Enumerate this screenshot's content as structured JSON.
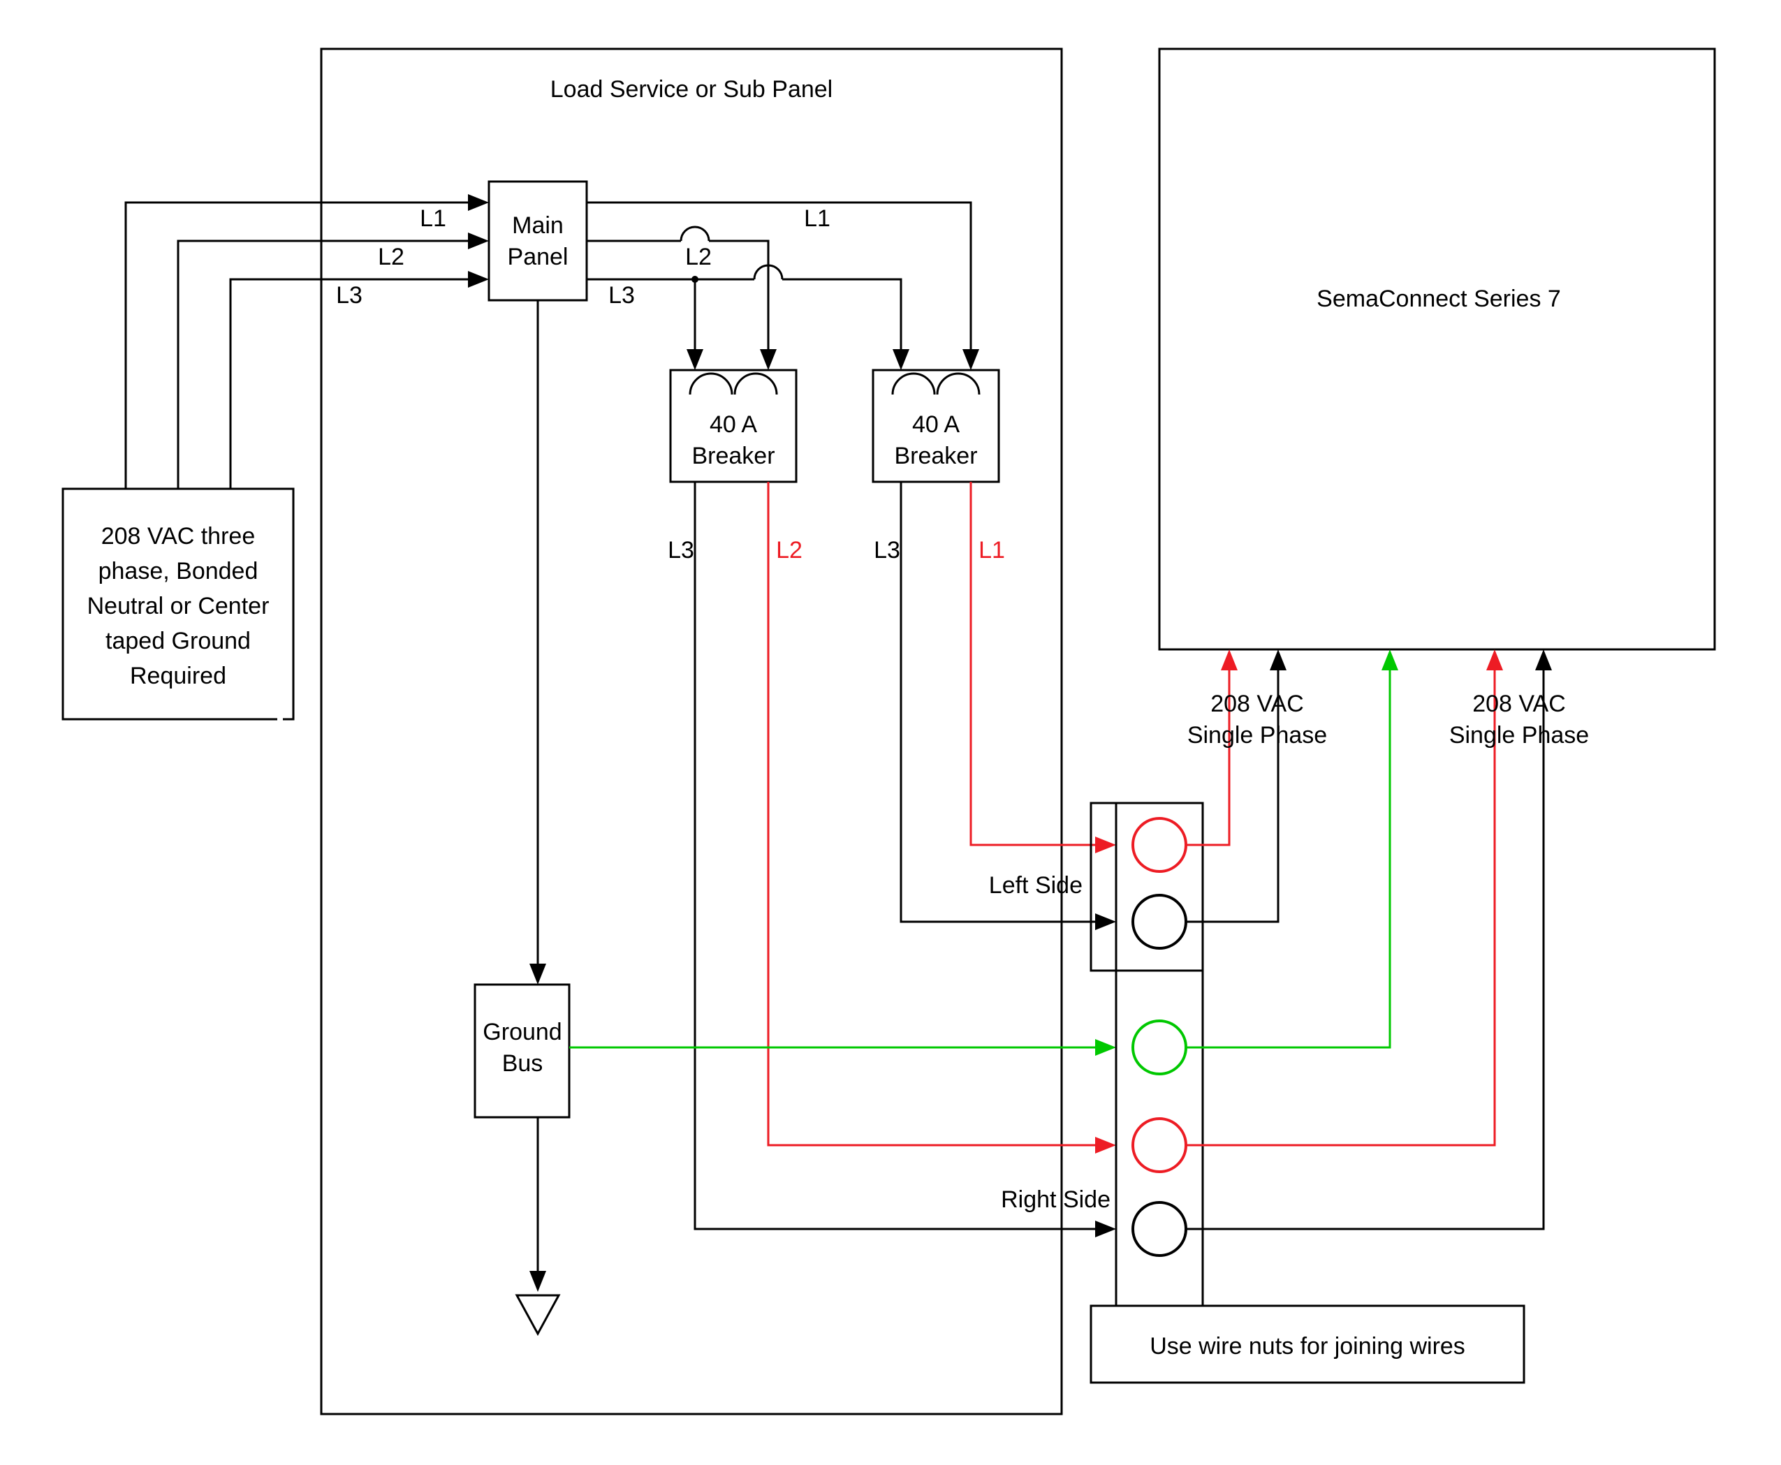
{
  "panel": {
    "title": "Load Service or Sub Panel",
    "main_panel": "Main Panel",
    "breaker1": {
      "amps": "40 A",
      "label": "Breaker"
    },
    "breaker2": {
      "amps": "40 A",
      "label": "Breaker"
    },
    "ground_bus": "Ground Bus"
  },
  "source": {
    "line1": "208 VAC three",
    "line2": "phase, Bonded",
    "line3": "Neutral or Center",
    "line4": "taped Ground",
    "line5": "Required"
  },
  "device": {
    "title": "SemaConnect Series 7",
    "phase1": {
      "line1": "208 VAC",
      "line2": "Single Phase"
    },
    "phase2": {
      "line1": "208 VAC",
      "line2": "Single Phase"
    },
    "left_side": "Left Side",
    "right_side": "Right Side",
    "wire_nuts": "Use wire nuts for joining wires"
  },
  "lines": {
    "L1": "L1",
    "L2": "L2",
    "L3": "L3"
  }
}
